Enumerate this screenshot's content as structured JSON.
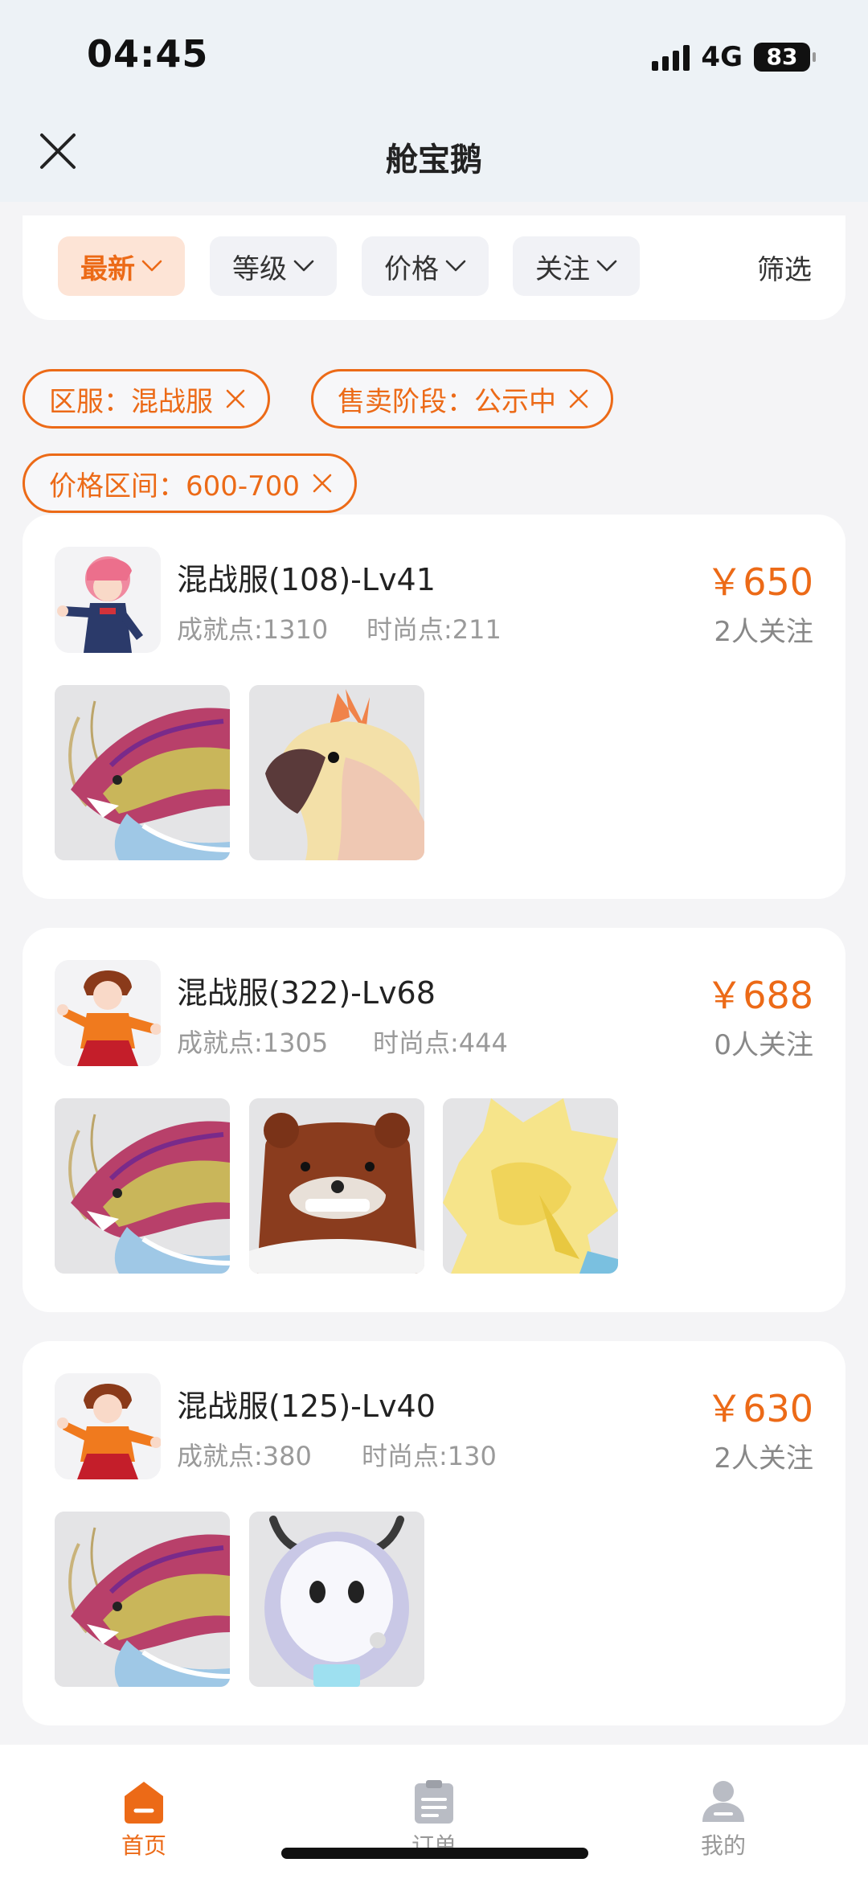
{
  "status_bar": {
    "time": "04:45",
    "network": "4G",
    "battery": "83"
  },
  "header": {
    "title": "舱宝鹅"
  },
  "sort_bar": {
    "items": [
      {
        "label": "最新",
        "active": true
      },
      {
        "label": "等级",
        "active": false
      },
      {
        "label": "价格",
        "active": false
      },
      {
        "label": "关注",
        "active": false
      }
    ],
    "filter_label": "筛选"
  },
  "active_filters": [
    {
      "label": "区服：混战服"
    },
    {
      "label": "售卖阶段：公示中"
    },
    {
      "label": "价格区间：600-700"
    }
  ],
  "listings": [
    {
      "title": "混战服(108)-Lv41",
      "achievement": "成就点:1310",
      "fashion": "时尚点:211",
      "price": "￥650",
      "followers": "2人关注",
      "avatar_icon": "pink-hair-girl-avatar",
      "pets": [
        "dragon-pet-icon",
        "cockatoo-pet-icon"
      ]
    },
    {
      "title": "混战服(322)-Lv68",
      "achievement": "成就点:1305",
      "fashion": "时尚点:444",
      "price": "￥688",
      "followers": "0人关注",
      "avatar_icon": "kungfu-boy-avatar",
      "pets": [
        "dragon-pet-icon",
        "bear-pet-icon",
        "golden-lion-pet-icon"
      ]
    },
    {
      "title": "混战服(125)-Lv40",
      "achievement": "成就点:380",
      "fashion": "时尚点:130",
      "price": "￥630",
      "followers": "2人关注",
      "avatar_icon": "kungfu-boy-avatar",
      "pets": [
        "dragon-pet-icon",
        "robot-cow-pet-icon"
      ]
    }
  ],
  "bottom_nav": {
    "items": [
      {
        "label": "首页",
        "icon": "home-icon",
        "active": true
      },
      {
        "label": "订单",
        "icon": "order-icon",
        "active": false
      },
      {
        "label": "我的",
        "icon": "profile-icon",
        "active": false
      }
    ]
  },
  "colors": {
    "accent": "#ec6a17",
    "accent_bg": "#fde4d6",
    "header_bg": "#edf2f6",
    "page_bg": "#f4f4f6"
  }
}
